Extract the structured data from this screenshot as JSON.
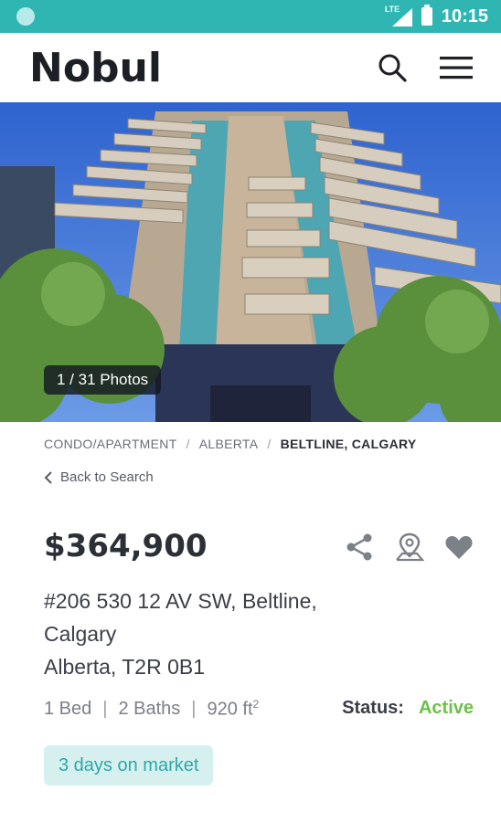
{
  "status_bar": {
    "time": "10:15",
    "network": "LTE"
  },
  "header": {
    "logo_text": "Nobul",
    "icons": [
      "search-icon",
      "menu-icon"
    ]
  },
  "photo": {
    "badge": "1 / 31 Photos"
  },
  "breadcrumb": {
    "items": [
      "CONDO/APARTMENT",
      "ALBERTA",
      "BELTLINE, CALGARY"
    ]
  },
  "back_link": "Back to Search",
  "listing": {
    "price": "$364,900",
    "address_line1": "#206 530 12 AV SW, Beltline,",
    "address_line2": "Calgary",
    "address_line3": "Alberta, T2R 0B1",
    "beds": "1 Bed",
    "baths": "2 Baths",
    "area": "920 ft",
    "area_unit_sup": "2",
    "status_label": "Status:",
    "status_value": "Active",
    "days_on_market": "3 days on market"
  },
  "colors": {
    "teal": "#2fb6b3",
    "active_green": "#6cc04a",
    "pill_bg": "#d6f0f0"
  },
  "actions": {
    "icons": [
      "share-icon",
      "map-pin-icon",
      "heart-icon"
    ]
  }
}
